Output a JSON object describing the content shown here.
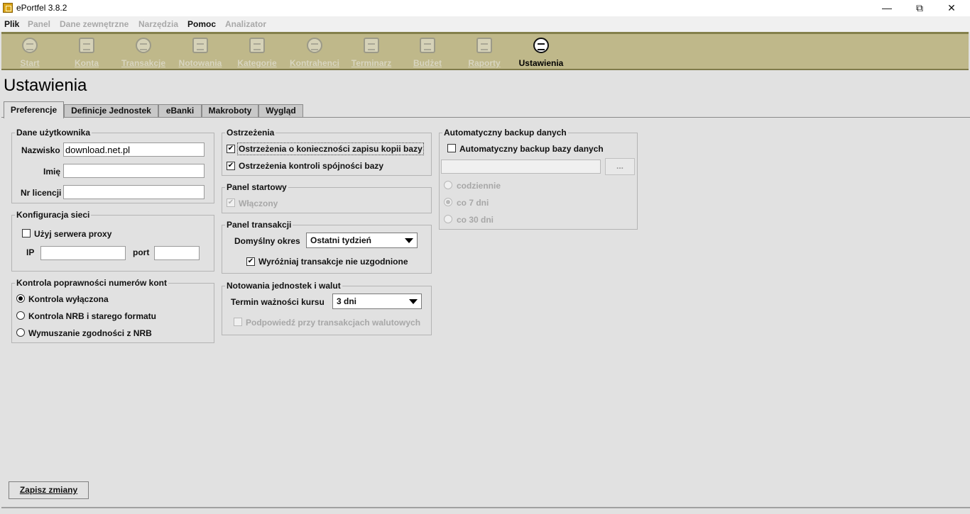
{
  "app": {
    "title": "ePortfel 3.8.2"
  },
  "window_controls": {
    "minimize": "—",
    "restore": "⧉",
    "close": "✕"
  },
  "menu": {
    "plik": "Plik",
    "panel": "Panel",
    "dane_zewnetrzne": "Dane zewnętrzne",
    "narzedzia": "Narzędzia",
    "pomoc": "Pomoc",
    "analizator": "Analizator"
  },
  "toolbar": {
    "start": "Start",
    "konta": "Konta",
    "transakcje": "Transakcje",
    "notowania": "Notowania",
    "kategorie": "Kategorie",
    "kontrahenci": "Kontrahenci",
    "terminarz": "Terminarz",
    "budzet": "Budżet",
    "raporty": "Raporty",
    "ustawienia": "Ustawienia"
  },
  "page": {
    "title": "Ustawienia"
  },
  "tabs": {
    "preferencje": "Preferencje",
    "definicje": "Definicje Jednostek",
    "ebanki": "eBanki",
    "makroboty": "Makroboty",
    "wyglad": "Wygląd"
  },
  "user_data": {
    "title": "Dane użytkownika",
    "nazwisko_label": "Nazwisko",
    "nazwisko_value": "download.net.pl",
    "imie_label": "Imię",
    "imie_value": "",
    "licencja_label": "Nr licencji",
    "licencja_value": ""
  },
  "network": {
    "title": "Konfiguracja sieci",
    "proxy_label": "Użyj serwera proxy",
    "proxy_checked": false,
    "ip_label": "IP",
    "ip_value": "",
    "port_label": "port",
    "port_value": ""
  },
  "account_check": {
    "title": "Kontrola poprawności numerów kont",
    "options": [
      "Kontrola wyłączona",
      "Kontrola NRB i starego formatu",
      "Wymuszanie zgodności z NRB"
    ],
    "selected": "Kontrola wyłączona"
  },
  "warnings": {
    "title": "Ostrzeżenia",
    "backup_warning": "Ostrzeżenia o konieczności zapisu kopii bazy",
    "consistency_warning": "Ostrzeżenia kontroli spójności bazy",
    "check_mark": "✔"
  },
  "start_panel": {
    "title": "Panel startowy",
    "enabled_label": "Włączony"
  },
  "transactions_panel": {
    "title": "Panel transakcji",
    "period_label": "Domyślny okres",
    "period_value": "Ostatni tydzień",
    "highlight_label": "Wyróżniaj transakcje nie uzgodnione"
  },
  "quotes": {
    "title": "Notowania jednostek i walut",
    "validity_label": "Termin ważności kursu",
    "validity_value": "3 dni",
    "suggest_label": "Podpowiedź przy transakcjach walutowych"
  },
  "backup": {
    "title": "Automatyczny backup danych",
    "auto_label": "Automatyczny backup bazy danych",
    "path_value": "",
    "browse_label": "...",
    "frequency": [
      "codziennie",
      "co 7 dni",
      "co 30 dni"
    ],
    "frequency_selected": "co 7 dni"
  },
  "actions": {
    "save": "Zapisz zmiany"
  }
}
